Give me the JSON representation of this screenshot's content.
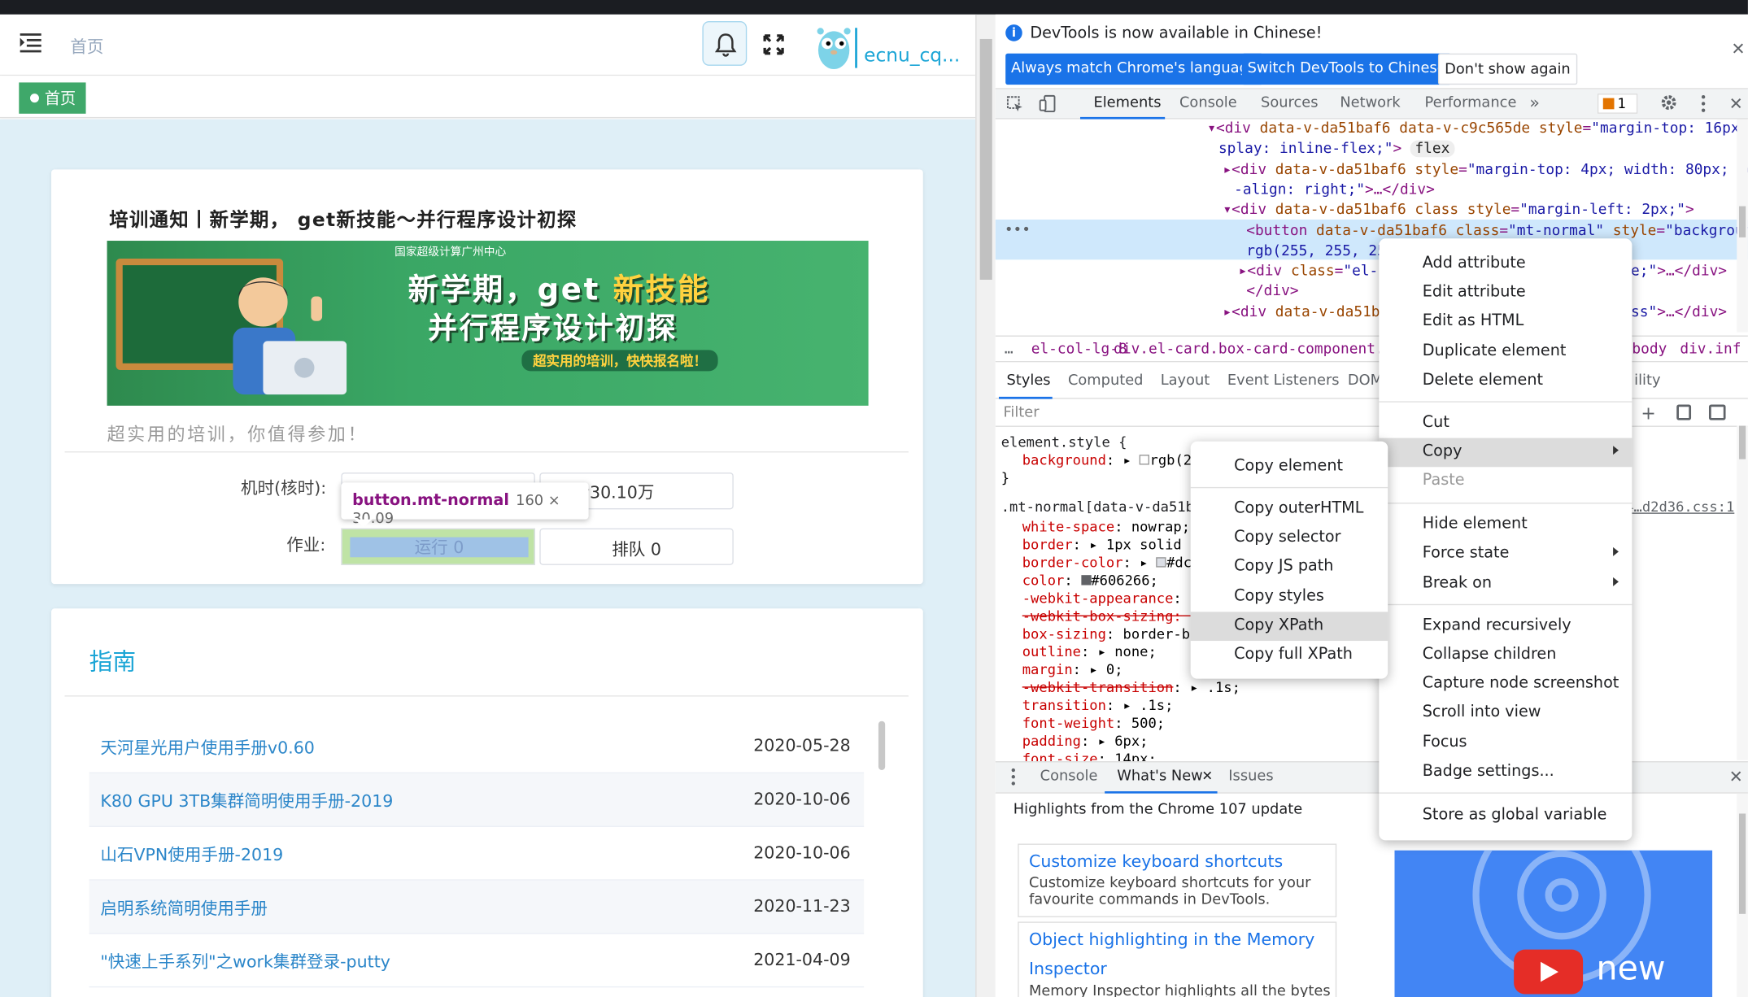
{
  "app": {
    "breadcrumb": "首页",
    "username": "ecnu_cq...",
    "tag": "首页",
    "notice_title": "培训通知丨新学期， get新技能～并行程序设计初探",
    "banner": {
      "top": "国家超级计算广州中心",
      "line1a": "新学期，get",
      "line1b": "新技能",
      "line2": "并行程序设计初探",
      "line3": "超实用的培训，快快报名啦！"
    },
    "subtitle": "超实用的培训，你值得参加！",
    "machine_label": "机时(核时):",
    "machine_remaining": "剩余30.10万",
    "jobs_label": "作业:",
    "running": "运行 0",
    "queued": "排队 0",
    "tooltip_name": "button.mt-normal",
    "tooltip_size": "160 × 30.09",
    "guide_title": "指南",
    "guides": [
      {
        "title": "天河星光用户使用手册v0.60",
        "date": "2020-05-28"
      },
      {
        "title": "K80 GPU 3TB集群简明使用手册-2019",
        "date": "2020-10-06"
      },
      {
        "title": "山石VPN使用手册-2019",
        "date": "2020-10-06"
      },
      {
        "title": "启明系统简明使用手册",
        "date": "2020-11-23"
      },
      {
        "title": "\"快速上手系列\"之work集群登录-putty",
        "date": "2021-04-09"
      }
    ]
  },
  "devtools": {
    "info": "DevTools is now available in Chinese!",
    "btn_match": "Always match Chrome's language",
    "btn_switch": "Switch DevTools to Chinese",
    "btn_dont": "Don't show again",
    "tabs": [
      "Elements",
      "Console",
      "Sources",
      "Network",
      "Performance"
    ],
    "more_tabs": "»",
    "warn_count": "1",
    "crumbs": [
      "el-col-lg-8",
      "div.el-card.box-card-component.chart-wr",
      "body",
      "div.inf"
    ],
    "subtabs": [
      "Styles",
      "Computed",
      "Layout",
      "Event Listeners",
      "DOM"
    ],
    "subtab_cut": "ility",
    "filter_placeholder": "Filter",
    "style_source": "4…d2d36.css:1",
    "drawer_tabs": [
      "Console",
      "What's New",
      "Issues"
    ],
    "highlights": "Highlights from the Chrome 107 update",
    "cards": [
      {
        "title": "Customize keyboard shortcuts",
        "body1": "Customize keyboard shortcuts for your",
        "body2": "favourite commands in DevTools."
      },
      {
        "title": "Object highlighting in the Memory",
        "title2": "Inspector",
        "body1": "Memory Inspector highlights all the bytes"
      }
    ],
    "video_text": "new"
  },
  "context_menu": {
    "items": [
      "Add attribute",
      "Edit attribute",
      "Edit as HTML",
      "Duplicate element",
      "Delete element",
      "Cut",
      "Copy",
      "Paste",
      "Hide element",
      "Force state",
      "Break on",
      "Expand recursively",
      "Collapse children",
      "Capture node screenshot",
      "Scroll into view",
      "Focus",
      "Badge settings...",
      "Store as global variable"
    ]
  },
  "copy_submenu": {
    "items": [
      "Copy element",
      "Copy outerHTML",
      "Copy selector",
      "Copy JS path",
      "Copy styles",
      "Copy XPath",
      "Copy full XPath"
    ]
  }
}
